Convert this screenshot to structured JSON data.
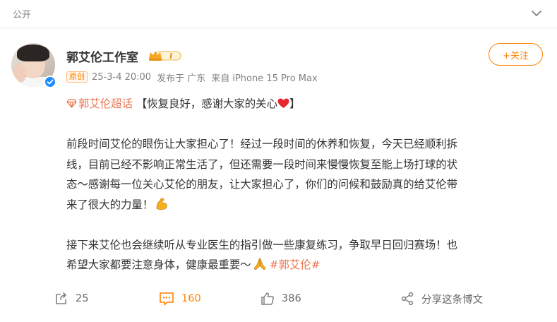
{
  "header": {
    "visibility": "公开"
  },
  "post": {
    "author": "郭艾伦工作室",
    "follow_label": "+关注",
    "original_tag": "原创",
    "datetime": "25-3-4 20:00",
    "posted_from": "发布于 广东",
    "device": "来自 iPhone 15 Pro Max",
    "supertopic": "郭艾伦超话",
    "headline": "【恢复良好，感谢大家的关心",
    "headline_end": "】",
    "body_lines": [
      "前段时间艾伦的眼伤让大家担心了！经过一段时间的休养和恢复，今天已经顺利拆",
      "线，目前已经不影响正常生活了，但还需要一段时间来慢慢恢复至能上场打球的状",
      "态～感谢每一位关心艾伦的朋友，让大家担心了，你们的问候和鼓励真的给艾伦带",
      "来了很大的力量！"
    ],
    "body2_lines": [
      "接下来艾伦也会继续听从专业医生的指引做一些康复练习，争取早日回归赛场！也",
      "希望大家都要注意身体，健康最重要～"
    ],
    "hashtag": "#郭艾伦#"
  },
  "actions": {
    "repost_count": "25",
    "comment_count": "160",
    "like_count": "386",
    "share_label": "分享这条博文"
  },
  "icons": {
    "collapse": "chevron-down-icon",
    "verified": "verified-icon",
    "vip": "vip-badge-icon",
    "supertopic": "diamond-icon",
    "heart": "red-heart-emoji",
    "muscle": "flexed-biceps-emoji",
    "pray": "folded-hands-emoji",
    "repost": "repost-icon",
    "comment": "comment-icon",
    "like": "thumbs-up-icon",
    "share": "share-icon"
  },
  "colors": {
    "accent": "#ff8200",
    "topic": "#eb7350",
    "verified": "#1a8cff",
    "text": "#333333",
    "muted": "#808080"
  }
}
